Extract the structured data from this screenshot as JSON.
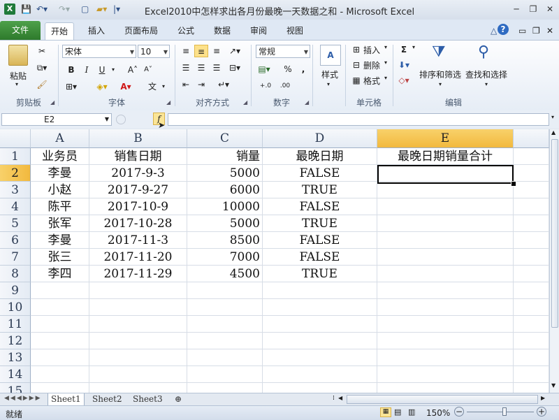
{
  "window": {
    "title": "Excel2010中怎样求出各月份最晚一天数据之和  -  Microsoft Excel",
    "min_icon": "minimize-icon",
    "max_icon": "restore-icon",
    "close_icon": "close-icon"
  },
  "tabs": [
    "文件",
    "开始",
    "插入",
    "页面布局",
    "公式",
    "数据",
    "审阅",
    "视图"
  ],
  "active_tab": "开始",
  "ribbon": {
    "clipboard": {
      "paste": "粘贴",
      "label": "剪贴板"
    },
    "font": {
      "name": "宋体",
      "size": "10",
      "bold": "B",
      "italic": "I",
      "underline": "U",
      "label": "字体",
      "wen": "文"
    },
    "alignment": {
      "label": "对齐方式"
    },
    "number": {
      "format": "常规",
      "percent": "%",
      "comma": ",",
      "inc": "+.0",
      "dec": ".00",
      "label": "数字"
    },
    "styles": {
      "button": "样式"
    },
    "cells": {
      "insert": "插入",
      "delete": "删除",
      "format": "格式",
      "label": "单元格"
    },
    "editing": {
      "sigma": "Σ",
      "sort": "排序和筛选",
      "find": "查找和选择",
      "label": "编辑"
    }
  },
  "formula_bar": {
    "name_box": "E2",
    "fx": "f",
    "value": ""
  },
  "columns": [
    "A",
    "B",
    "C",
    "D",
    "E"
  ],
  "selected_column": "E",
  "rows": [
    "1",
    "2",
    "3",
    "4",
    "5",
    "6",
    "7",
    "8",
    "9",
    "10",
    "11",
    "12",
    "13",
    "14",
    "15"
  ],
  "selected_row": "2",
  "header_row": [
    "业务员",
    "销售日期",
    "销量",
    "最晚日期",
    "最晚日期销量合计"
  ],
  "data_rows": [
    [
      "李曼",
      "2017-9-3",
      "5000",
      "FALSE",
      ""
    ],
    [
      "小赵",
      "2017-9-27",
      "6000",
      "TRUE",
      ""
    ],
    [
      "陈平",
      "2017-10-9",
      "10000",
      "FALSE",
      ""
    ],
    [
      "张军",
      "2017-10-28",
      "5000",
      "TRUE",
      ""
    ],
    [
      "李曼",
      "2017-11-3",
      "8500",
      "FALSE",
      ""
    ],
    [
      "张三",
      "2017-11-20",
      "7000",
      "FALSE",
      ""
    ],
    [
      "李四",
      "2017-11-29",
      "4500",
      "TRUE",
      ""
    ]
  ],
  "sheets": [
    "Sheet1",
    "Sheet2",
    "Sheet3"
  ],
  "active_sheet": "Sheet1",
  "status": {
    "mode": "就绪",
    "zoom": "150%",
    "minus": "−",
    "plus": "+"
  }
}
